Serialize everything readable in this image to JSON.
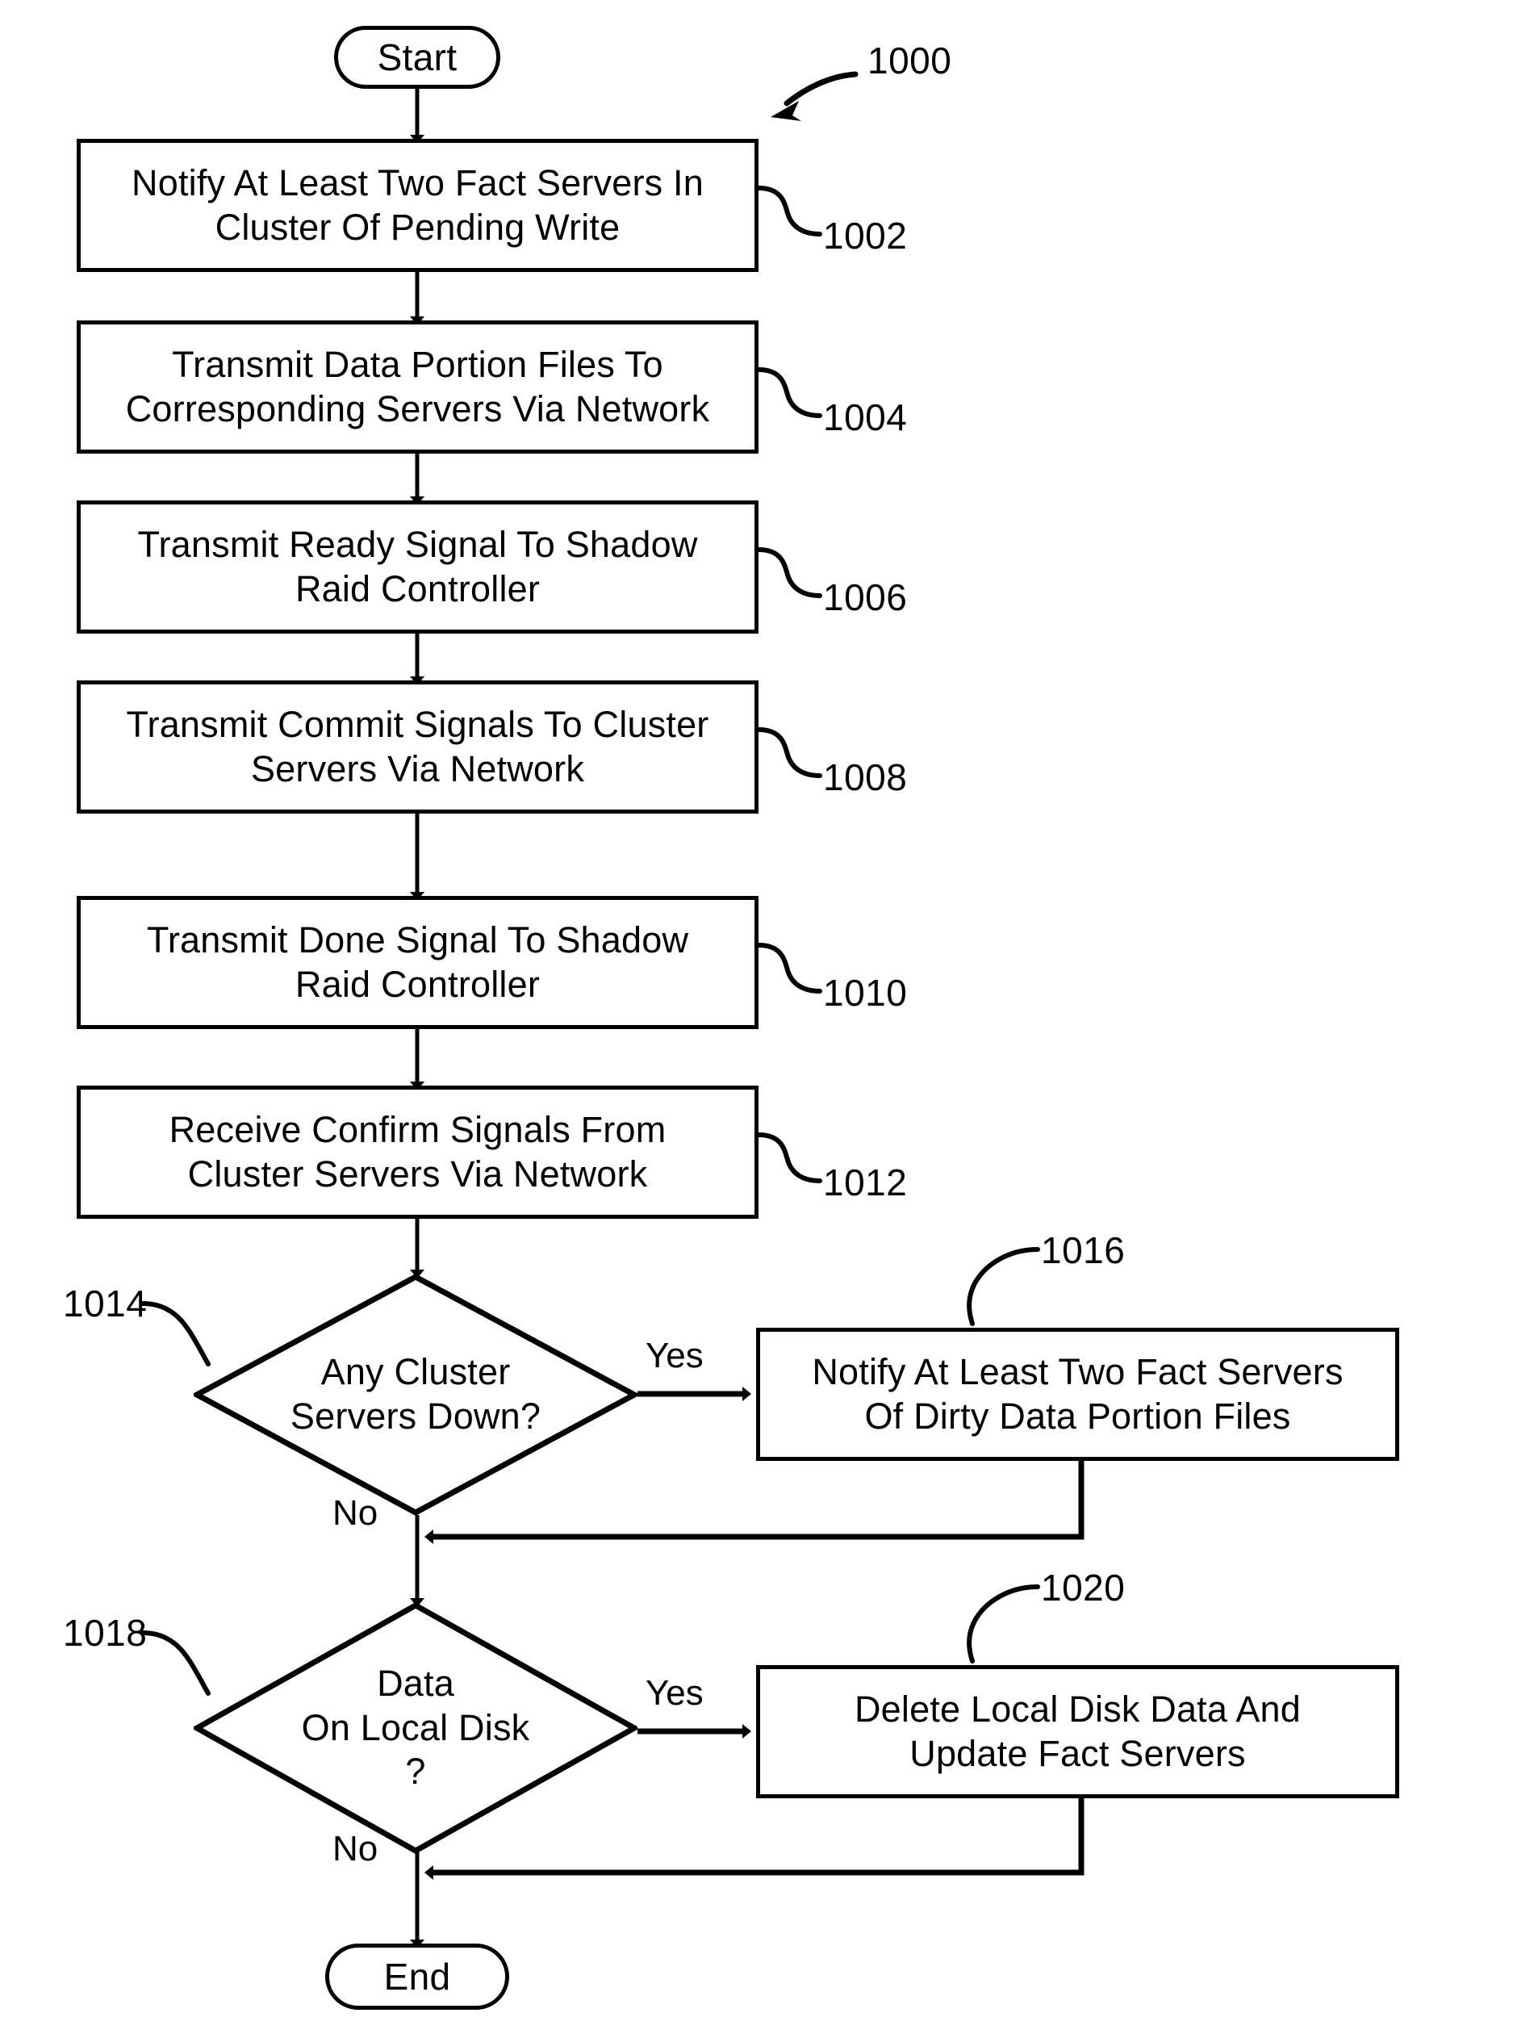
{
  "figure": {
    "label": "1000",
    "type": "patent-flowchart"
  },
  "nodes": {
    "start": {
      "label": "Start",
      "shape": "terminator"
    },
    "end": {
      "label": "End",
      "shape": "terminator"
    },
    "s1002": {
      "ref": "1002",
      "shape": "process",
      "line1": "Notify At Least Two Fact Servers In",
      "line2": "Cluster Of Pending Write"
    },
    "s1004": {
      "ref": "1004",
      "shape": "process",
      "line1": "Transmit Data Portion Files To",
      "line2": "Corresponding Servers Via Network"
    },
    "s1006": {
      "ref": "1006",
      "shape": "process",
      "line1": "Transmit Ready Signal To Shadow",
      "line2": "Raid Controller"
    },
    "s1008": {
      "ref": "1008",
      "shape": "process",
      "line1": "Transmit Commit Signals To Cluster",
      "line2": "Servers Via Network"
    },
    "s1010": {
      "ref": "1010",
      "shape": "process",
      "line1": "Transmit Done Signal To Shadow",
      "line2": "Raid Controller"
    },
    "s1012": {
      "ref": "1012",
      "shape": "process",
      "line1": "Receive Confirm Signals From",
      "line2": "Cluster Servers Via Network"
    },
    "d1014": {
      "ref": "1014",
      "shape": "decision",
      "line1": "Any Cluster",
      "line2": "Servers Down?",
      "line3": ""
    },
    "s1016": {
      "ref": "1016",
      "shape": "process",
      "line1": "Notify At Least Two Fact Servers",
      "line2": "Of Dirty Data Portion Files"
    },
    "d1018": {
      "ref": "1018",
      "shape": "decision",
      "line1": "Data",
      "line2": "On Local Disk",
      "line3": "?"
    },
    "s1020": {
      "ref": "1020",
      "shape": "process",
      "line1": "Delete Local Disk Data And",
      "line2": "Update Fact Servers"
    }
  },
  "edge_labels": {
    "yes_1014": "Yes",
    "no_1014": "No",
    "yes_1018": "Yes",
    "no_1018": "No"
  },
  "colors": {
    "stroke": "#000000",
    "fill": "#ffffff",
    "text": "#000000"
  }
}
